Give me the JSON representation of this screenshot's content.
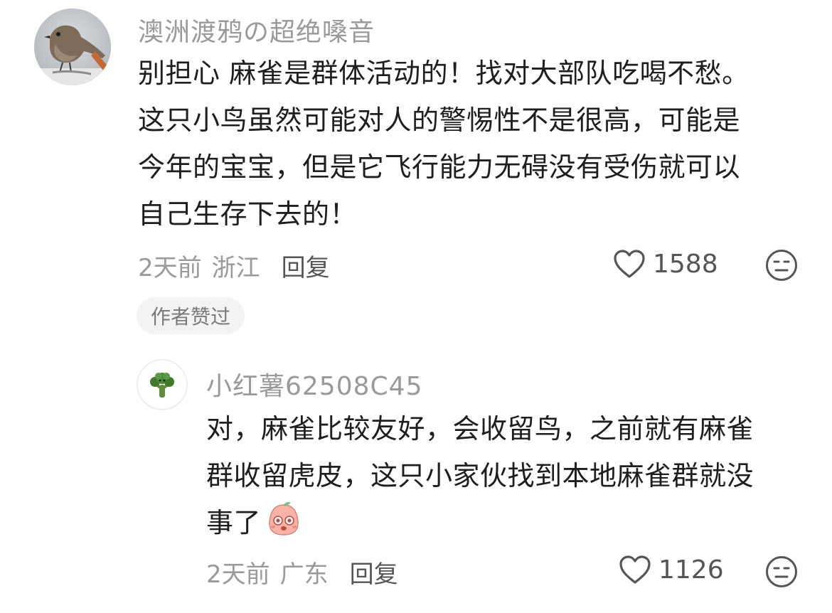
{
  "comments": [
    {
      "username": "澳洲渡鸦の超绝嗓音",
      "avatar_icon": "bird-photo-avatar",
      "lines": [
        "别担心 麻雀是群体活动的！找对大部队吃喝不愁。",
        "这只小鸟虽然可能对人的警惕性不是很高，可能是",
        "今年的宝宝，但是它飞行能力无碍没有受伤就可以",
        "自己生存下去的！"
      ],
      "time": "2天前",
      "location": "浙江",
      "reply_label": "回复",
      "likes": "1588",
      "author_badge": "作者赞过"
    },
    {
      "username": "小红薯62508C45",
      "avatar_icon": "broccoli-avatar",
      "lines": [
        "对，麻雀比较友好，会收留鸟，之前就有麻雀",
        "群收留虎皮，这只小家伙找到本地麻雀群就没",
        "事了"
      ],
      "time": "2天前",
      "location": "广东",
      "reply_label": "回复",
      "likes": "1126"
    }
  ],
  "colors": {
    "username": "#9a9a9a",
    "text": "#1e1e1e",
    "meta": "#9a9a9a",
    "badge_bg": "#f3f3f3"
  }
}
